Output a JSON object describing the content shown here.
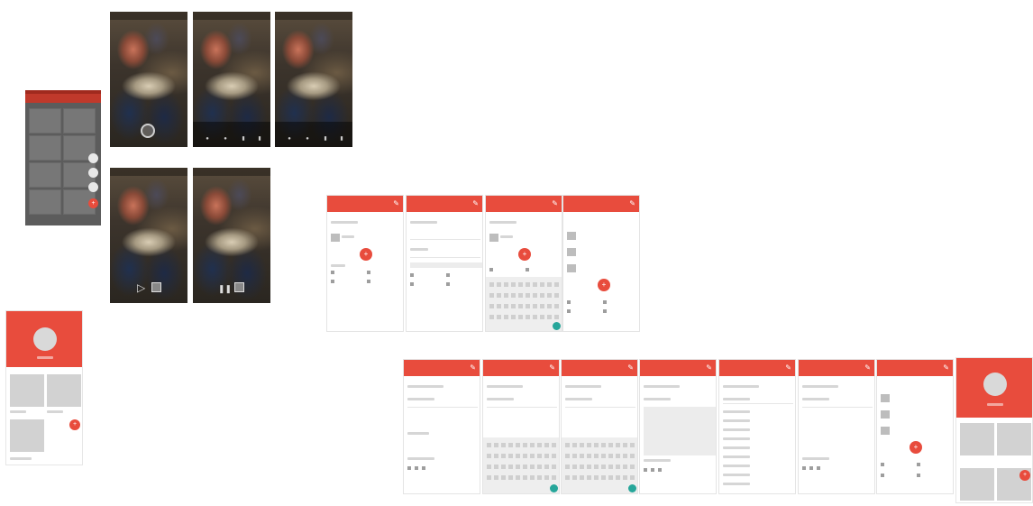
{
  "photo_screens": [
    {
      "id": "capture",
      "has_shutter": true
    },
    {
      "id": "edit-a",
      "has_tools": true
    },
    {
      "id": "edit-b",
      "has_tools": true
    },
    {
      "id": "play",
      "controls": [
        "play",
        "stop"
      ]
    },
    {
      "id": "pause",
      "controls": [
        "pause",
        "stop"
      ]
    }
  ],
  "play_icons": {
    "play": "▷",
    "pause": "❚❚"
  },
  "fab_icons": {
    "add": "+",
    "edit": "✎"
  },
  "colors": {
    "primary": "#e84c3d",
    "primary_dark": "#c0392b",
    "accent_green": "#26a69a",
    "grid_bg": "#5c5c5c"
  }
}
